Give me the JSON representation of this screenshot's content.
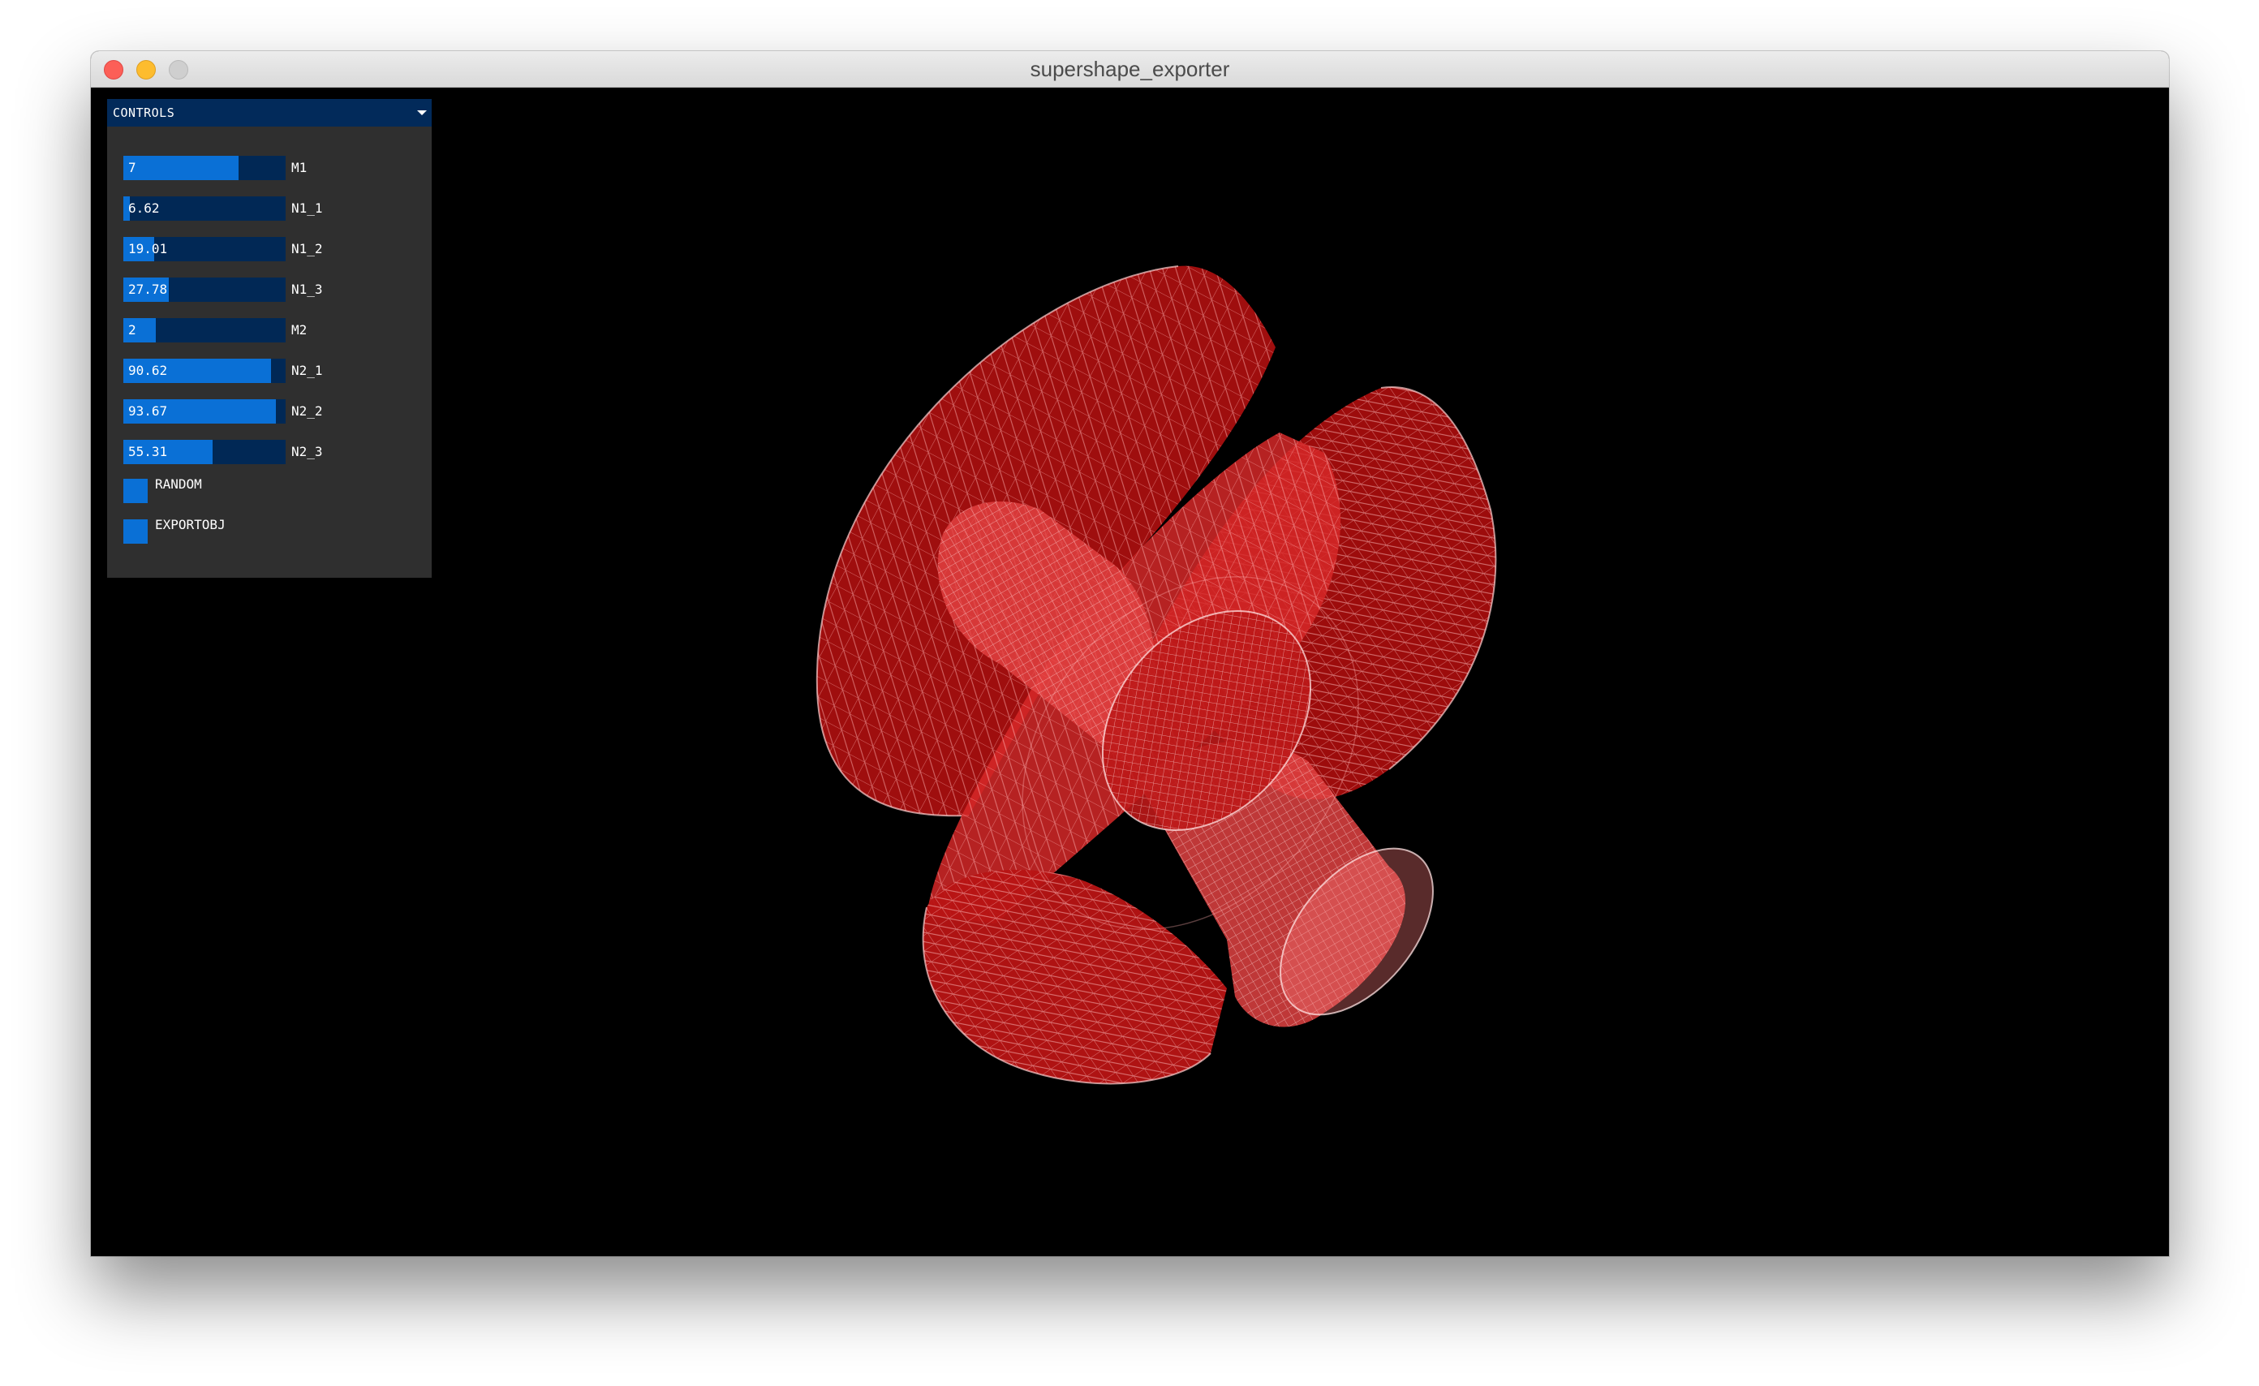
{
  "window": {
    "title": "supershape_exporter"
  },
  "controls": {
    "title": "CONTROLS",
    "collapse_icon": "triangle-down-icon",
    "sliders": [
      {
        "label": "M1",
        "value": "7",
        "fraction": 0.71
      },
      {
        "label": "N1_1",
        "value": "6.62",
        "fraction": 0.04
      },
      {
        "label": "N1_2",
        "value": "19.01",
        "fraction": 0.19
      },
      {
        "label": "N1_3",
        "value": "27.78",
        "fraction": 0.28
      },
      {
        "label": "M2",
        "value": "2",
        "fraction": 0.2
      },
      {
        "label": "N2_1",
        "value": "90.62",
        "fraction": 0.91
      },
      {
        "label": "N2_2",
        "value": "93.67",
        "fraction": 0.94
      },
      {
        "label": "N2_3",
        "value": "55.31",
        "fraction": 0.55
      }
    ],
    "toggles": [
      {
        "label": "RANDOM"
      },
      {
        "label": "EXPORTOBJ"
      }
    ]
  },
  "colors": {
    "slider_fill": "#0a70d6",
    "slider_track": "#012855",
    "panel_bg": "#2f2f2f",
    "shape_fill": "#c41a1a",
    "wire": "#f6bcbc"
  }
}
